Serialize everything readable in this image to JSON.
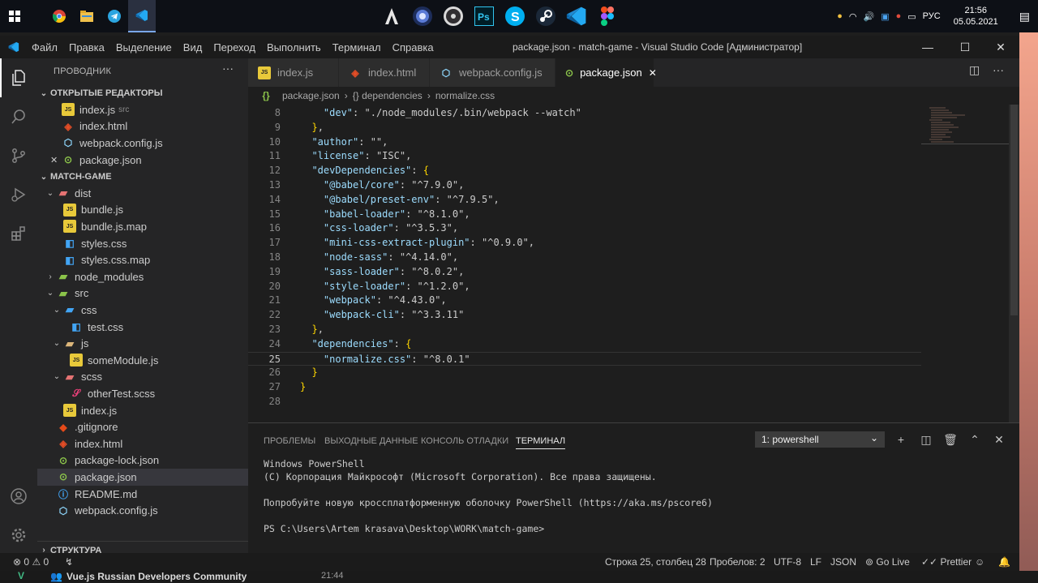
{
  "taskbar": {
    "apps": [
      "start-icon",
      "chrome-icon",
      "explorer-icon",
      "telegram-icon",
      "vscode-icon"
    ],
    "pinned": [
      "assassins-creed-icon",
      "cinema4d-icon",
      "obs-icon",
      "photoshop-icon",
      "skype-icon",
      "steam-icon",
      "vscode-icon",
      "figma-icon"
    ],
    "tray": {
      "lang": "РУС",
      "time": "21:56",
      "date": "05.05.2021"
    }
  },
  "window": {
    "title": "package.json - match-game - Visual Studio Code [Администратор]",
    "menu": [
      "Файл",
      "Правка",
      "Выделение",
      "Вид",
      "Переход",
      "Выполнить",
      "Терминал",
      "Справка"
    ]
  },
  "sidebar": {
    "title": "ПРОВОДНИК",
    "more": "···",
    "open_editors_title": "ОТКРЫТЫЕ РЕДАКТОРЫ",
    "open_editors": [
      {
        "name": "index.js",
        "suffix": "src",
        "icon": "js"
      },
      {
        "name": "index.html",
        "suffix": "",
        "icon": "html"
      },
      {
        "name": "webpack.config.js",
        "suffix": "",
        "icon": "web"
      },
      {
        "name": "package.json",
        "suffix": "",
        "icon": "json"
      }
    ],
    "project_title": "MATCH-GAME",
    "tree": [
      {
        "name": "dist",
        "type": "folder-open",
        "depth": 1
      },
      {
        "name": "bundle.js",
        "type": "js",
        "depth": 2
      },
      {
        "name": "bundle.js.map",
        "type": "js",
        "depth": 2
      },
      {
        "name": "styles.css",
        "type": "css",
        "depth": 2
      },
      {
        "name": "styles.css.map",
        "type": "css",
        "depth": 2
      },
      {
        "name": "node_modules",
        "type": "folder",
        "depth": 1
      },
      {
        "name": "src",
        "type": "folder-open",
        "depth": 1
      },
      {
        "name": "css",
        "type": "folder-open",
        "depth": 2
      },
      {
        "name": "test.css",
        "type": "css",
        "depth": 3
      },
      {
        "name": "js",
        "type": "folder-open",
        "depth": 2
      },
      {
        "name": "someModule.js",
        "type": "js",
        "depth": 3
      },
      {
        "name": "scss",
        "type": "folder-open",
        "depth": 2
      },
      {
        "name": "otherTest.scss",
        "type": "scss",
        "depth": 3
      },
      {
        "name": "index.js",
        "type": "js",
        "depth": 2
      },
      {
        "name": ".gitignore",
        "type": "git",
        "depth": 1
      },
      {
        "name": "index.html",
        "type": "html",
        "depth": 1
      },
      {
        "name": "package-lock.json",
        "type": "json",
        "depth": 1
      },
      {
        "name": "package.json",
        "type": "json",
        "depth": 1
      },
      {
        "name": "README.md",
        "type": "md",
        "depth": 1
      },
      {
        "name": "webpack.config.js",
        "type": "web",
        "depth": 1
      }
    ],
    "outline_title": "СТРУКТУРА"
  },
  "tabs": [
    {
      "label": "index.js",
      "icon": "js",
      "active": false
    },
    {
      "label": "index.html",
      "icon": "html",
      "active": false
    },
    {
      "label": "webpack.config.js",
      "icon": "web",
      "active": false
    },
    {
      "label": "package.json",
      "icon": "json",
      "active": true,
      "close": "✕"
    }
  ],
  "breadcrumb": [
    "package.json",
    "{} dependencies",
    "normalize.css"
  ],
  "code": [
    {
      "n": "8",
      "text": "    \"dev\": \"./node_modules/.bin/webpack --watch\""
    },
    {
      "n": "9",
      "text": "  },"
    },
    {
      "n": "10",
      "text": "  \"author\": \"\","
    },
    {
      "n": "11",
      "text": "  \"license\": \"ISC\","
    },
    {
      "n": "12",
      "text": "  \"devDependencies\": {"
    },
    {
      "n": "13",
      "text": "    \"@babel/core\": \"^7.9.0\","
    },
    {
      "n": "14",
      "text": "    \"@babel/preset-env\": \"^7.9.5\","
    },
    {
      "n": "15",
      "text": "    \"babel-loader\": \"^8.1.0\","
    },
    {
      "n": "16",
      "text": "    \"css-loader\": \"^3.5.3\","
    },
    {
      "n": "17",
      "text": "    \"mini-css-extract-plugin\": \"^0.9.0\","
    },
    {
      "n": "18",
      "text": "    \"node-sass\": \"^4.14.0\","
    },
    {
      "n": "19",
      "text": "    \"sass-loader\": \"^8.0.2\","
    },
    {
      "n": "20",
      "text": "    \"style-loader\": \"^1.2.0\","
    },
    {
      "n": "21",
      "text": "    \"webpack\": \"^4.43.0\","
    },
    {
      "n": "22",
      "text": "    \"webpack-cli\": \"^3.3.11\""
    },
    {
      "n": "23",
      "text": "  },"
    },
    {
      "n": "24",
      "text": "  \"dependencies\": {"
    },
    {
      "n": "25",
      "text": "    \"normalize.css\": \"^8.0.1\""
    },
    {
      "n": "26",
      "text": "  }"
    },
    {
      "n": "27",
      "text": "}"
    },
    {
      "n": "28",
      "text": ""
    }
  ],
  "current_line": "25",
  "panel": {
    "tabs": [
      "ПРОБЛЕМЫ",
      "ВЫХОДНЫЕ ДАННЫЕ",
      "КОНСОЛЬ ОТЛАДКИ",
      "ТЕРМИНАЛ"
    ],
    "active_tab": "ТЕРМИНАЛ",
    "terminal_select": "1: powershell",
    "terminal_lines": [
      "Windows PowerShell",
      "(C) Корпорация Майкрософт (Microsoft Corporation). Все права защищены.",
      "",
      "Попробуйте новую кроссплатформенную оболочку PowerShell (https://aka.ms/pscore6)",
      "",
      "PS C:\\Users\\Artem krasava\\Desktop\\WORK\\match-game>"
    ]
  },
  "statusbar": {
    "errors": "0",
    "warnings": "0",
    "position": "Строка 25, столбец 28",
    "spaces": "Пробелов: 2",
    "encoding": "UTF-8",
    "eol": "LF",
    "language": "JSON",
    "golive": "Go Live",
    "prettier": "Prettier"
  },
  "bottom_strip": {
    "text": "Vue.js Russian Developers Community",
    "time": "21:44"
  },
  "colors": {
    "accent": "#007acc",
    "key": "#9cdcfe",
    "string": "#ce9178"
  }
}
